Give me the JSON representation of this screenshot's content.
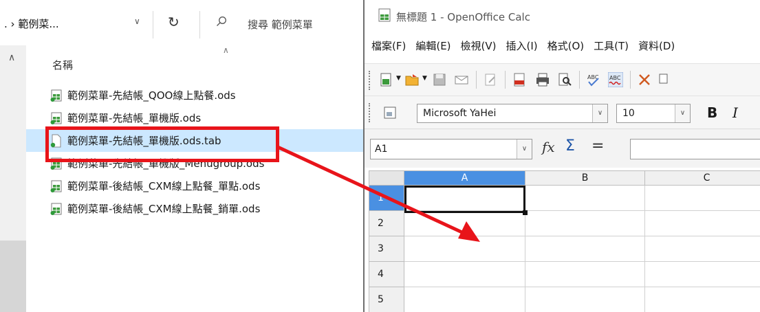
{
  "explorer": {
    "path_prefix": ". ›",
    "path_folder": "範例菜...",
    "search_placeholder": "搜尋 範例菜單",
    "column_name": "名稱",
    "files": [
      {
        "name": "範例菜單-先結帳_QOO線上點餐.ods",
        "icon": "calc-document-icon",
        "selected": false
      },
      {
        "name": "範例菜單-先結帳_單機版.ods",
        "icon": "calc-document-icon",
        "selected": false
      },
      {
        "name": "範例菜單-先結帳_單機版.ods.tab",
        "icon": "plain-file-icon",
        "selected": true
      },
      {
        "name": "範例菜單-先結帳_單機版_Menugroup.ods",
        "icon": "calc-document-icon",
        "selected": false
      },
      {
        "name": "範例菜單-後結帳_CXM線上點餐_單點.ods",
        "icon": "calc-document-icon",
        "selected": false
      },
      {
        "name": "範例菜單-後結帳_CXM線上點餐_銷單.ods",
        "icon": "calc-document-icon",
        "selected": false
      }
    ]
  },
  "calc": {
    "title": "無標題 1 - OpenOffice Calc",
    "menu": [
      "檔案(F)",
      "編輯(E)",
      "檢視(V)",
      "插入(I)",
      "格式(O)",
      "工具(T)",
      "資料(D)"
    ],
    "font_name": "Microsoft YaHei",
    "font_size": "10",
    "bold_label": "B",
    "italic_label": "I",
    "name_box": "A1",
    "fx_label": "fx",
    "sigma_label": "Σ",
    "equals_label": "=",
    "columns": [
      "A",
      "B",
      "C"
    ],
    "rows": [
      "1",
      "2",
      "3",
      "4",
      "5"
    ],
    "active_cell": "A1"
  },
  "colors": {
    "highlight": "#e8141a",
    "selection": "#cce8ff",
    "active_header": "#4a90e2"
  }
}
